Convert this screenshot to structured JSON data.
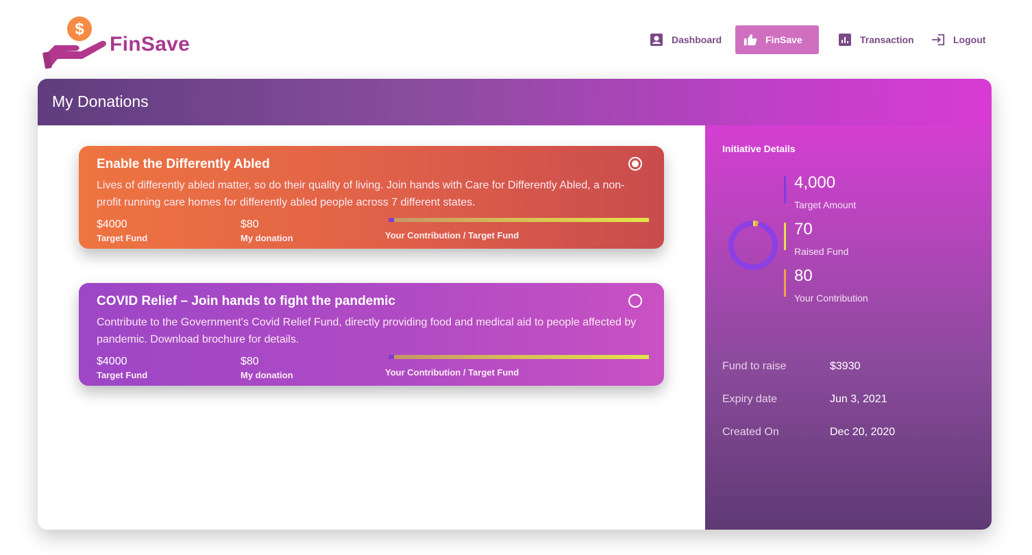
{
  "brand": {
    "name": "FinSave"
  },
  "nav": {
    "items": [
      {
        "label": "Dashboard",
        "icon": "account-box-icon"
      },
      {
        "label": "FinSave",
        "icon": "thumbs-up-icon",
        "active": true
      },
      {
        "label": "Transaction",
        "icon": "bar-chart-icon"
      },
      {
        "label": "Logout",
        "icon": "logout-icon"
      }
    ]
  },
  "page": {
    "title": "My Donations"
  },
  "donations": [
    {
      "title": "Enable the Differently Abled",
      "description": "Lives of differently abled matter, so do their quality of living. Join hands with Care for Differently Abled, a non-profit running care homes for differently abled people across 7 different states.",
      "target_fund": "$4000",
      "target_fund_label": "Target Fund",
      "my_donation": "$80",
      "my_donation_label": "My donation",
      "progress_label": "Your Contribution / Target Fund",
      "progress_fraction": 0.02,
      "selected": true
    },
    {
      "title": "COVID Relief – Join hands to fight the pandemic",
      "description": "Contribute to the Government's Covid Relief Fund, directly providing food and medical aid to people affected by pandemic. Download brochure for details.",
      "target_fund": "$4000",
      "target_fund_label": "Target Fund",
      "my_donation": "$80",
      "my_donation_label": "My donation",
      "progress_label": "Your Contribution / Target Fund",
      "progress_fraction": 0.02,
      "selected": false
    }
  ],
  "initiative": {
    "title": "Initiative Details",
    "metrics": [
      {
        "value": "4,000",
        "label": "Target Amount",
        "color": "#7b3fe0"
      },
      {
        "value": "70",
        "label": "Raised Fund",
        "color": "#e7e04c"
      },
      {
        "value": "80",
        "label": "Your Contribution",
        "color": "#f3a04a"
      }
    ],
    "donut": {
      "target": 4000,
      "raised": 70,
      "contribution": 80,
      "ring_color": "#8c3fe3"
    },
    "details": [
      {
        "key": "Fund to raise",
        "value": "$3930"
      },
      {
        "key": "Expiry date",
        "value": "Jun 3, 2021"
      },
      {
        "key": "Created On",
        "value": "Dec 20, 2020"
      }
    ]
  }
}
